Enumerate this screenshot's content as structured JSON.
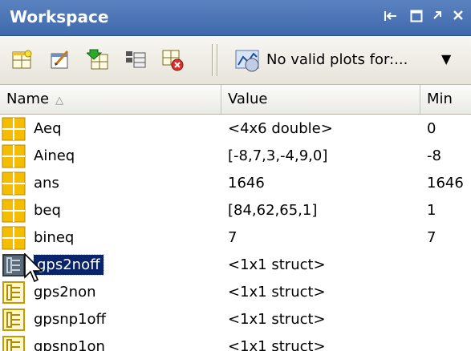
{
  "window": {
    "title": "Workspace",
    "buttons": {
      "undock": "⇤",
      "maximize": "☐",
      "undock_arrow": "↗",
      "close": "✕"
    }
  },
  "toolbar": {
    "icons": [
      "new-variable-icon",
      "open-selection-icon",
      "load-data-icon",
      "save-icon",
      "print-icon",
      "delete-icon"
    ],
    "plot_selector": "No valid plots for:..."
  },
  "table": {
    "columns": [
      "Name",
      "Value",
      "Min"
    ],
    "sort_indicator": "△",
    "rows": [
      {
        "name": "Aeq",
        "value": "<4x6 double>",
        "min": "0",
        "icon": "matrix-icon"
      },
      {
        "name": "Aineq",
        "value": "[-8,7,3,-4,9,0]",
        "min": "-8",
        "icon": "matrix-icon"
      },
      {
        "name": "ans",
        "value": "1646",
        "min": "1646",
        "icon": "matrix-icon"
      },
      {
        "name": "beq",
        "value": "[84,62,65,1]",
        "min": "1",
        "icon": "matrix-icon"
      },
      {
        "name": "bineq",
        "value": "7",
        "min": "7",
        "icon": "matrix-icon"
      },
      {
        "name": "gps2noff",
        "value": "<1x1 struct>",
        "min": "",
        "icon": "struct-icon",
        "selected": true
      },
      {
        "name": "gps2non",
        "value": "<1x1 struct>",
        "min": "",
        "icon": "struct-icon"
      },
      {
        "name": "gpsnp1off",
        "value": "<1x1 struct>",
        "min": "",
        "icon": "struct-icon"
      },
      {
        "name": "gpsnp1on",
        "value": "<1x1 struct>",
        "min": "",
        "icon": "struct-icon"
      }
    ]
  },
  "colors": {
    "titlebar": "#4a72b5",
    "selection": "#0a246a",
    "matrix_icon": "#f2b800",
    "struct_icon": "#e2a400"
  }
}
